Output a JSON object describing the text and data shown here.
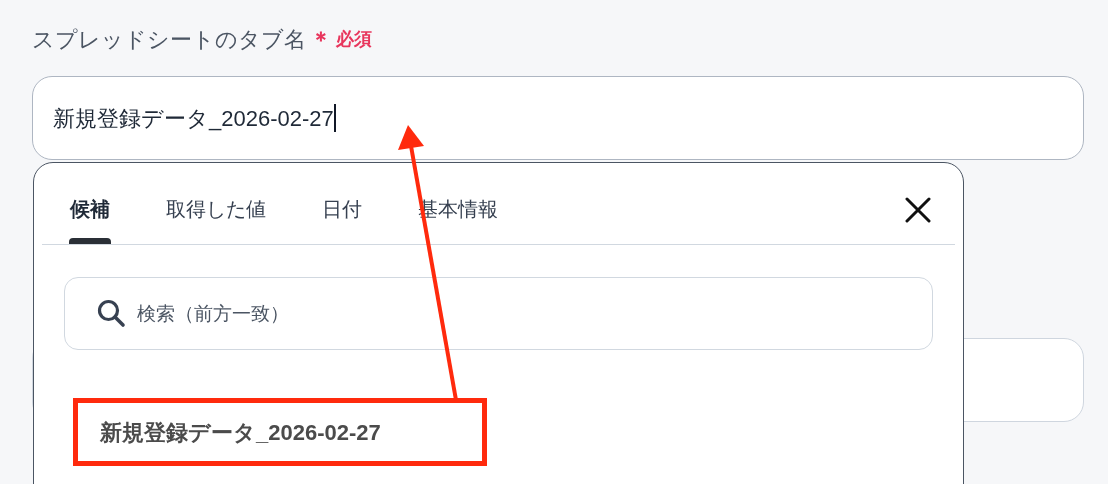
{
  "field": {
    "label": "スプレッドシートのタブ名",
    "required_mark": "＊",
    "required_text": "必須",
    "value": "新規登録データ_2026-02-27",
    "focused": true
  },
  "popup": {
    "tabs": [
      {
        "label": "候補",
        "selected": true
      },
      {
        "label": "取得した値",
        "selected": false
      },
      {
        "label": "日付",
        "selected": false
      },
      {
        "label": "基本情報",
        "selected": false
      }
    ],
    "search": {
      "placeholder": "検索（前方一致）"
    },
    "suggestions": [
      {
        "label": "新規登録データ_2026-02-27",
        "highlighted": true
      }
    ]
  }
}
